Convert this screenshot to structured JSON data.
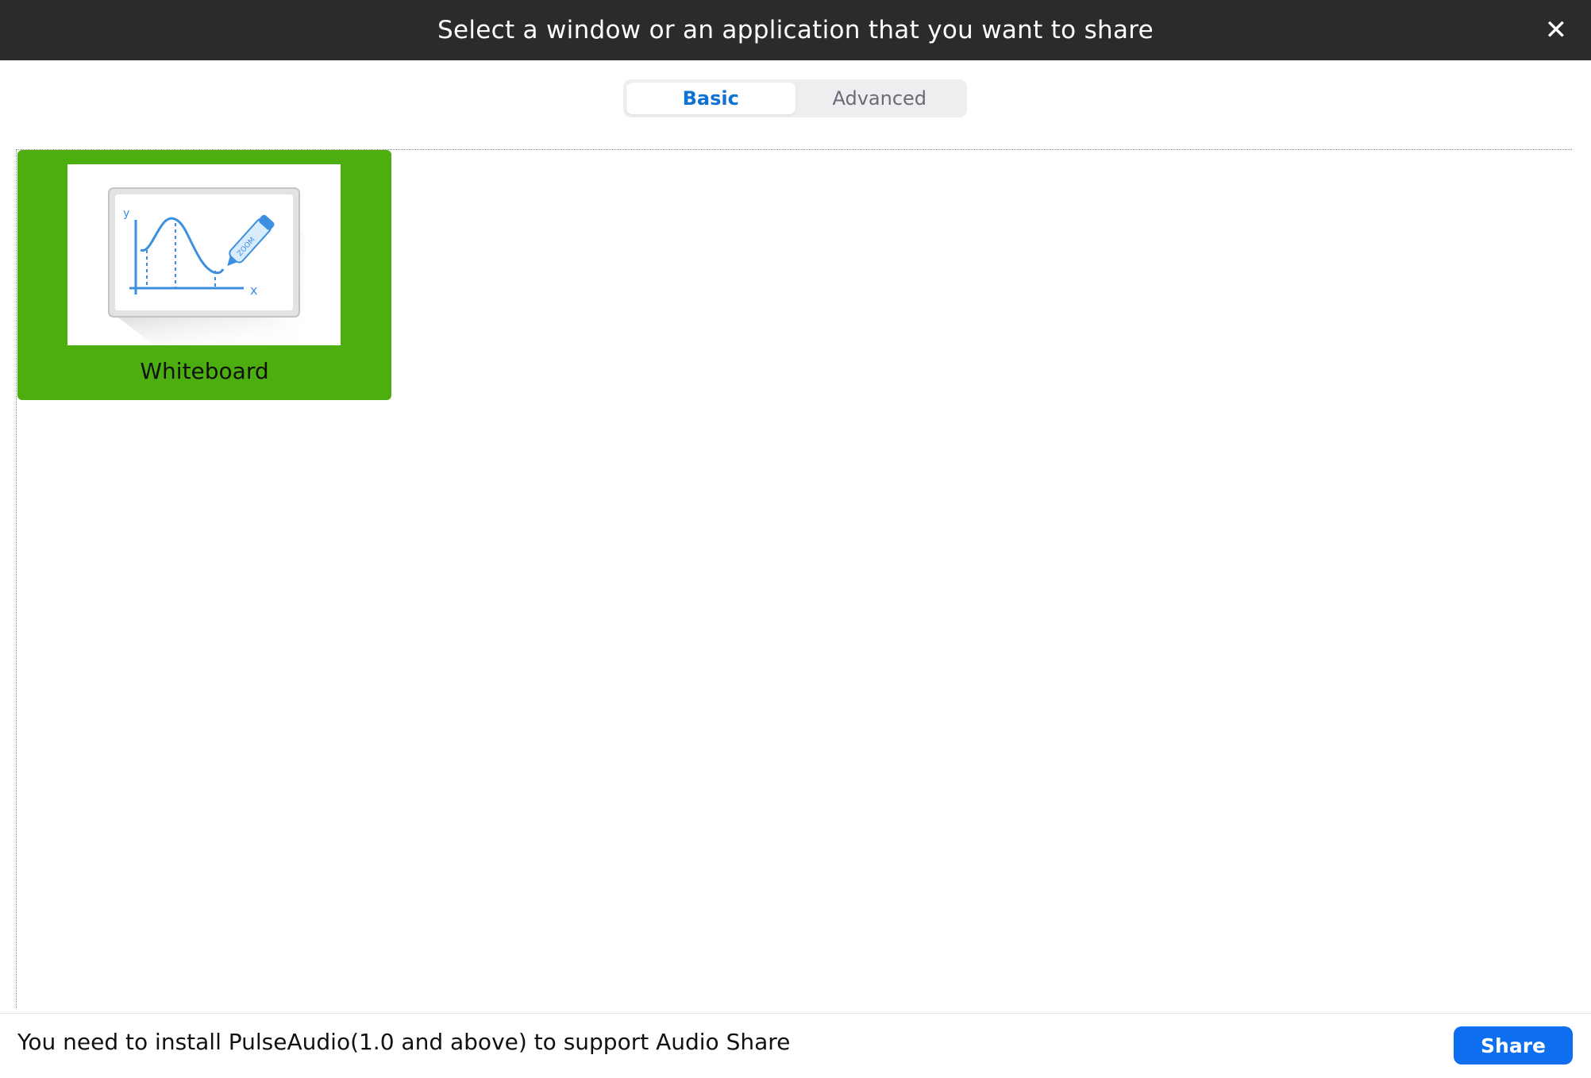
{
  "window": {
    "title": "Select a window or an application that you want to share",
    "close_glyph": "✕"
  },
  "tabs": [
    {
      "label": "Basic",
      "active": true
    },
    {
      "label": "Advanced",
      "active": false
    }
  ],
  "items": [
    {
      "label": "Whiteboard",
      "selected": true,
      "icon": "whiteboard-chart-icon",
      "axis_x": "x",
      "axis_y": "y",
      "marker_text": "ZOOM"
    }
  ],
  "footer": {
    "message": "You need to install PulseAudio(1.0 and above) to support Audio Share",
    "share_label": "Share"
  },
  "colors": {
    "selected_bg": "#4caf0f",
    "accent": "#0e6ef0",
    "tab_active_text": "#0e72d4",
    "titlebar_bg": "#2b2b2b"
  }
}
